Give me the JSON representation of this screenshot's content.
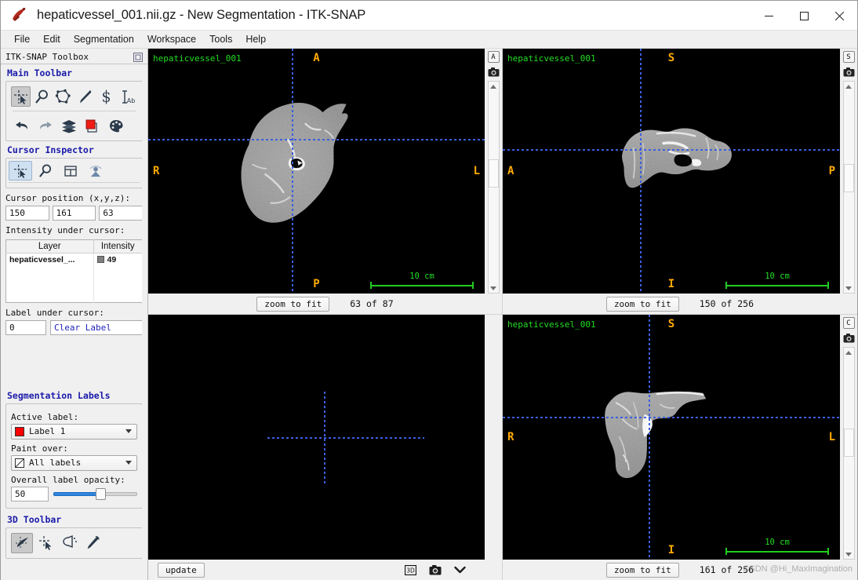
{
  "window": {
    "title": "hepaticvessel_001.nii.gz - New Segmentation - ITK-SNAP",
    "minimize": "—",
    "maximize": "□",
    "close": "✕"
  },
  "menubar": {
    "items": [
      "File",
      "Edit",
      "Segmentation",
      "Workspace",
      "Tools",
      "Help"
    ]
  },
  "toolbox": {
    "header": "ITK-SNAP Toolbox",
    "main_toolbar_title": "Main Toolbar",
    "main_tools": [
      "crosshair-tool",
      "zoom-pan-tool",
      "polygon-tool",
      "paintbrush-tool",
      "snake-tool",
      "annotation-tool"
    ],
    "action_tools": [
      "undo-icon",
      "redo-icon",
      "layers-icon",
      "label-color-icon",
      "palette-icon"
    ],
    "cursor_inspector_title": "Cursor Inspector",
    "cursor_tabs": [
      "crosshair-inspector-tab",
      "zoom-inspector-tab",
      "grid-inspector-tab",
      "intensity-curve-tab"
    ],
    "cursor_position_label": "Cursor position (x,y,z):",
    "cursor_position": [
      "150",
      "161",
      "63"
    ],
    "intensity_label": "Intensity under cursor:",
    "intensity_table": {
      "columns": [
        "Layer",
        "Intensity"
      ],
      "rows": [
        {
          "layer": "hepaticvessel_...",
          "intensity": "49"
        }
      ]
    },
    "label_under_cursor_label": "Label under cursor:",
    "label_under_cursor_value": "0",
    "label_under_cursor_name": "Clear Label",
    "segmentation_labels_title": "Segmentation Labels",
    "active_label_label": "Active label:",
    "active_label_value": "Label 1",
    "active_label_color": "#ff0000",
    "paint_over_label": "Paint over:",
    "paint_over_value": "All labels",
    "opacity_label": "Overall label opacity:",
    "opacity_value": "50",
    "toolbar_3d_title": "3D Toolbar",
    "tools_3d": [
      "3d-crosshair-tool",
      "3d-pick-tool",
      "3d-spraypaint-tool",
      "3d-scalpel-tool"
    ]
  },
  "viewports": [
    {
      "id": "axial",
      "image_label": "hepaticvessel_001",
      "orient_top": "A",
      "orient_bottom": "P",
      "orient_left": "R",
      "orient_right": "L",
      "side_button": "A",
      "scale_bar": "10 cm",
      "zoom_button": "zoom to fit",
      "slice_text": "63 of 87",
      "camera_icon": "camera-icon"
    },
    {
      "id": "sagittal",
      "image_label": "hepaticvessel_001",
      "orient_top": "S",
      "orient_bottom": "I",
      "orient_left": "A",
      "orient_right": "P",
      "side_button": "S",
      "scale_bar": "10 cm",
      "zoom_button": "zoom to fit",
      "slice_text": "150 of 256",
      "camera_icon": "camera-icon"
    },
    {
      "id": "render3d",
      "image_label": "",
      "update_button": "update",
      "icons": [
        "3d-view-icon",
        "camera-icon",
        "chevron-down-icon"
      ]
    },
    {
      "id": "coronal",
      "image_label": "hepaticvessel_001",
      "orient_top": "S",
      "orient_bottom": "I",
      "orient_left": "R",
      "orient_right": "L",
      "side_button": "C",
      "scale_bar": "10 cm",
      "zoom_button": "zoom to fit",
      "slice_text": "161 of 256",
      "camera_icon": "camera-icon"
    }
  ],
  "watermark": "CSDN @Hi_MaxImagination",
  "colors": {
    "accent_blue": "#1a1aaa",
    "crosshair": "#3b5fe0",
    "overlay_green": "#22dd22",
    "orientation_orange": "#ffaa00",
    "label1": "#ff0000",
    "slider_fill": "#2f86e0"
  }
}
